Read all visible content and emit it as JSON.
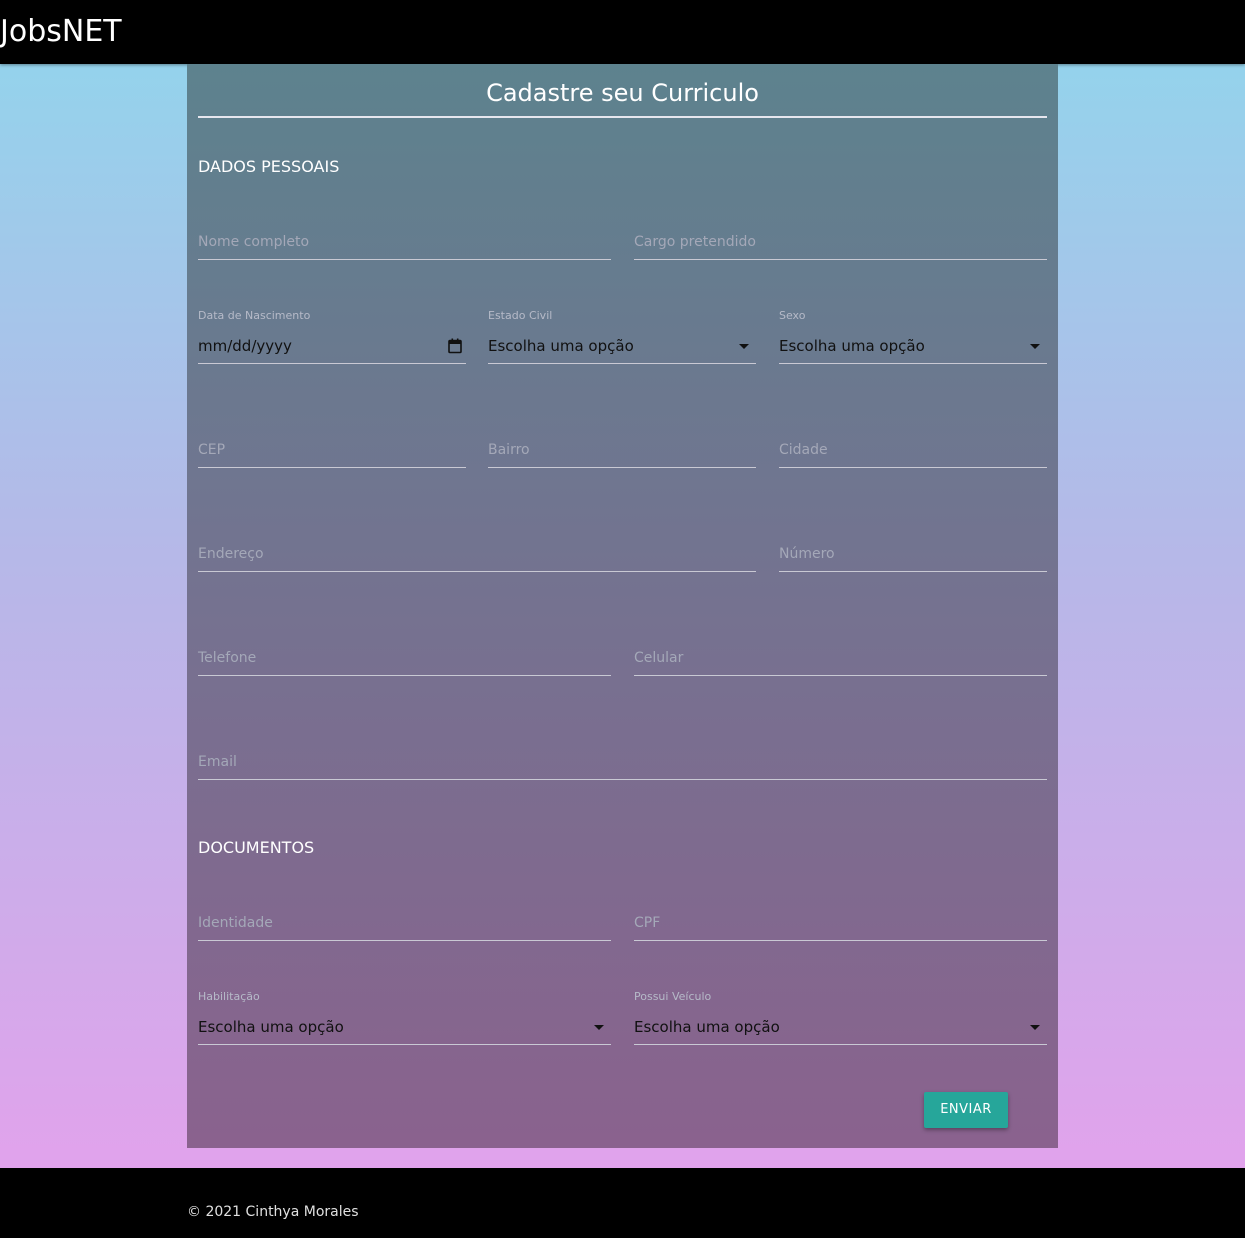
{
  "app": {
    "brand": "JobsNET"
  },
  "form": {
    "title": "Cadastre seu Curriculo",
    "sections": {
      "personal": "DADOS PESSOAIS",
      "documents": "DOCUMENTOS"
    },
    "fields": {
      "nome": {
        "placeholder": "Nome completo"
      },
      "cargo": {
        "placeholder": "Cargo pretendido"
      },
      "nascimento": {
        "label": "Data de Nascimento",
        "value": "mm/dd/yyyy"
      },
      "estado_civil": {
        "label": "Estado Civil",
        "value": "Escolha uma opção"
      },
      "sexo": {
        "label": "Sexo",
        "value": "Escolha uma opção"
      },
      "cep": {
        "placeholder": "CEP"
      },
      "bairro": {
        "placeholder": "Bairro"
      },
      "cidade": {
        "placeholder": "Cidade"
      },
      "endereco": {
        "placeholder": "Endereço"
      },
      "numero": {
        "placeholder": "Número"
      },
      "telefone": {
        "placeholder": "Telefone"
      },
      "celular": {
        "placeholder": "Celular"
      },
      "email": {
        "placeholder": "Email"
      },
      "identidade": {
        "placeholder": "Identidade"
      },
      "cpf": {
        "placeholder": "CPF"
      },
      "habilitacao": {
        "label": "Habilitação",
        "value": "Escolha uma opção"
      },
      "veiculo": {
        "label": "Possui Veículo",
        "value": "Escolha uma opção"
      }
    },
    "submit_label": "ENVIAR"
  },
  "footer": {
    "copyright": "© 2021 Cinthya Morales"
  },
  "icons": {
    "date": "calendar-icon",
    "dropdown": "caret-down-icon"
  }
}
